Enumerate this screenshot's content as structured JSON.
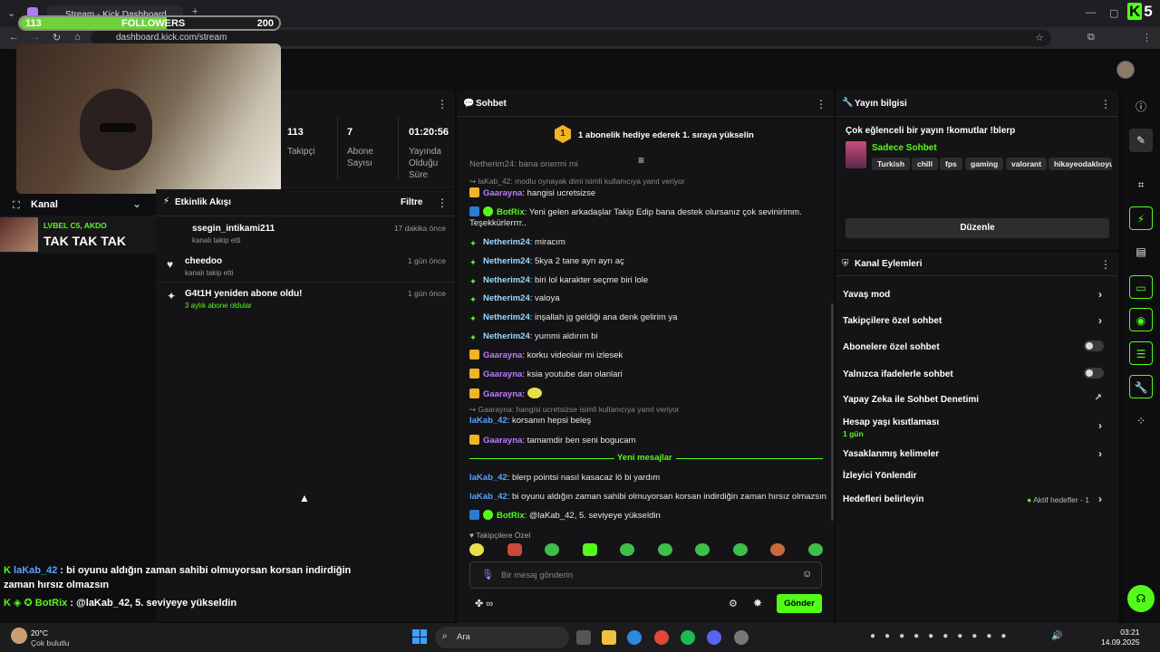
{
  "browser": {
    "tab_title": "Stream - Kick Dashboard",
    "url": "dashboard.kick.com/stream"
  },
  "overlay": {
    "followers_label": "FOLLOWERS",
    "followers_current": "113",
    "followers_goal": "200",
    "followers_progress": 0.565,
    "kick_logo": "K",
    "kick_digit": "5",
    "chat_lines": [
      {
        "user": "laKab_42",
        "text": "bi oyunu aldığın zaman sahibi olmuyorsan korsan indirdiğin zaman hırsız olmazsın"
      },
      {
        "user": "BotRix",
        "text": "@laKab_42, 5. seviyeye yükseldin"
      }
    ]
  },
  "sidebar": {
    "channel_label": "Kanal",
    "live_title": "LVBEL C5, AKDO",
    "live_subtitle": "TAK TAK TAK"
  },
  "stats": {
    "followers_value": "113",
    "followers_label": "Takipçi",
    "subs_value": "7",
    "subs_label": "Abone Sayısı",
    "uptime_value": "01:20:56",
    "uptime_label": "Yayında Olduğu Süre"
  },
  "activity": {
    "title": "Etkinlik Akışı",
    "filter": "Filtre",
    "items": [
      {
        "name": "ssegin_intikami211",
        "sub": "kanalı takip etti",
        "time": "17 dakika önce"
      },
      {
        "name": "cheedoo",
        "sub": "kanalı takip etti",
        "time": "1 gün önce"
      },
      {
        "name": "G4t1H yeniden abone oldu!",
        "sub": "3 aylık abone oldular",
        "time": "1 gün önce"
      }
    ]
  },
  "chat": {
    "title": "Sohbet",
    "gift_banner": "1 abonelik hediye ederek 1. sıraya yükselin",
    "rank": "1",
    "top_partial": "Netherim24: bana onermi mi",
    "messages": [
      {
        "reply": "laKab_42: modlu oynayak dimi isimli kullanıcıya yanıt veriyor"
      },
      {
        "user": "Gaarayna",
        "cls": "u-purple",
        "text": ": hangisi ucretsizse"
      },
      {
        "user": "BotRix",
        "cls": "u-bot",
        "text": ": Yeni gelen arkadaşlar Takip Edip bana destek olursanız çok sevinirimm."
      },
      {
        "text_only": "Teşekkürlerrrr.."
      },
      {
        "user": "Netherim24",
        "cls": "u-green",
        "text": ": miracım"
      },
      {
        "user": "Netherim24",
        "cls": "u-green",
        "text": ": 5kya 2 tane ayrı ayrı aç"
      },
      {
        "user": "Netherim24",
        "cls": "u-green",
        "text": ": biri lol karakter seçme biri lole"
      },
      {
        "user": "Netherim24",
        "cls": "u-green",
        "text": ": valoya"
      },
      {
        "user": "Netherim24",
        "cls": "u-green",
        "text": ": inşallah jg geldiği ana denk gelirim ya"
      },
      {
        "user": "Netherim24",
        "cls": "u-green",
        "text": ": yummi aldırım bi"
      },
      {
        "user": "Gaarayna",
        "cls": "u-purple",
        "text": ": korku videolair mi izlesek"
      },
      {
        "user": "Gaarayna",
        "cls": "u-purple",
        "text": ": ksia youtube dan olanlari"
      },
      {
        "user": "Gaarayna",
        "cls": "u-purple",
        "text": ":"
      },
      {
        "reply": "Gaarayna: hangisi ucretsizse isimli kullanıcıya yanıt veriyor"
      },
      {
        "user": "laKab_42",
        "cls": "u-blue",
        "text": ": korsanın hepsi beleş"
      },
      {
        "user": "Gaarayna",
        "cls": "u-purple",
        "text": ": tamamdir ben seni bogucam"
      }
    ],
    "new_messages": "Yeni mesajlar",
    "after": [
      {
        "user": "laKab_42",
        "cls": "u-blue",
        "text": ": blerp pointsi nasıl kasacaz lö bi yardım"
      },
      {
        "user": "laKab_42",
        "cls": "u-blue",
        "text": ": bi oyunu aldığın zaman sahibi olmuyorsan korsan indirdiğin zaman hırsız olmazsın"
      },
      {
        "user": "BotRix",
        "cls": "u-bot",
        "text": ": @laKab_42, 5. seviyeye yükseldin"
      }
    ],
    "followers_only": "Takipçilere Özel",
    "input_placeholder": "Bir mesaj gönderin",
    "send": "Gönder"
  },
  "stream_info": {
    "title": "Yayın bilgisi",
    "stream_title": "Çok eğlenceli bir yayın !komutlar !blerp",
    "category": "Sadece Sohbet",
    "tags": [
      "Turkish",
      "chill",
      "fps",
      "gaming",
      "valorant",
      "hikayeodaklıoyu"
    ],
    "edit": "Düzenle"
  },
  "channel_actions": {
    "title": "Kanal Eylemleri",
    "rows": [
      {
        "label": "Yavaş mod",
        "kind": "chevron"
      },
      {
        "label": "Takipçilere özel sohbet",
        "kind": "chevron"
      },
      {
        "label": "Abonelere özel sohbet",
        "kind": "toggle"
      },
      {
        "label": "Yalnızca ifadelerle sohbet",
        "kind": "toggle"
      },
      {
        "label": "Yapay Zeka ile Sohbet Denetimi",
        "kind": "external"
      },
      {
        "label": "Hesap yaşı kısıtlaması",
        "kind": "chevron",
        "sub": "1 gün"
      },
      {
        "label": "Yasaklanmış kelimeler",
        "kind": "chevron"
      },
      {
        "label": "İzleyici Yönlendir",
        "kind": "none"
      },
      {
        "label": "Hedefleri belirleyin",
        "kind": "chevron",
        "extra": "Aktif hedefler - 1"
      }
    ]
  },
  "taskbar": {
    "temp": "20°C",
    "weather": "Çok bulutlu",
    "search": "Ara",
    "time": "03:21",
    "date": "14.09.2025"
  },
  "colors": {
    "accent": "#53fc18",
    "bg": "#0e0e10",
    "panel": "#141416"
  }
}
